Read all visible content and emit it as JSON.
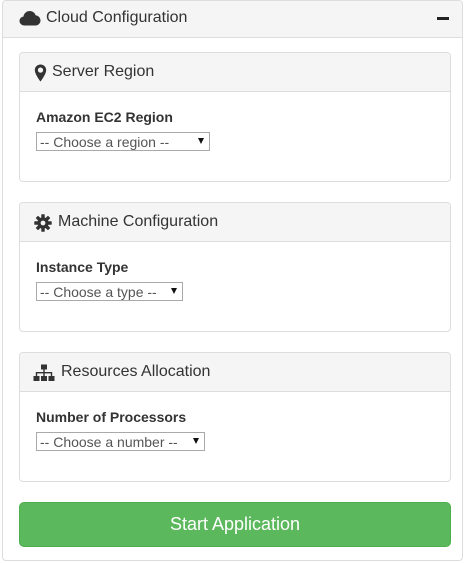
{
  "panel": {
    "title": "Cloud Configuration",
    "title_icon": "cloud-icon",
    "collapse_icon": "minus-icon"
  },
  "sections": [
    {
      "title": "Server Region",
      "icon": "map-marker-icon",
      "field_label": "Amazon EC2 Region",
      "select_value": "-- Choose a region --"
    },
    {
      "title": "Machine Configuration",
      "icon": "gear-icon",
      "field_label": "Instance Type",
      "select_value": "-- Choose a type --"
    },
    {
      "title": "Resources Allocation",
      "icon": "sitemap-icon",
      "field_label": "Number of Processors",
      "select_value": "-- Choose a number --"
    }
  ],
  "actions": {
    "start_label": "Start Application"
  },
  "colors": {
    "success": "#5cb85c",
    "panel_header": "#f5f5f5",
    "border": "#dddddd"
  }
}
